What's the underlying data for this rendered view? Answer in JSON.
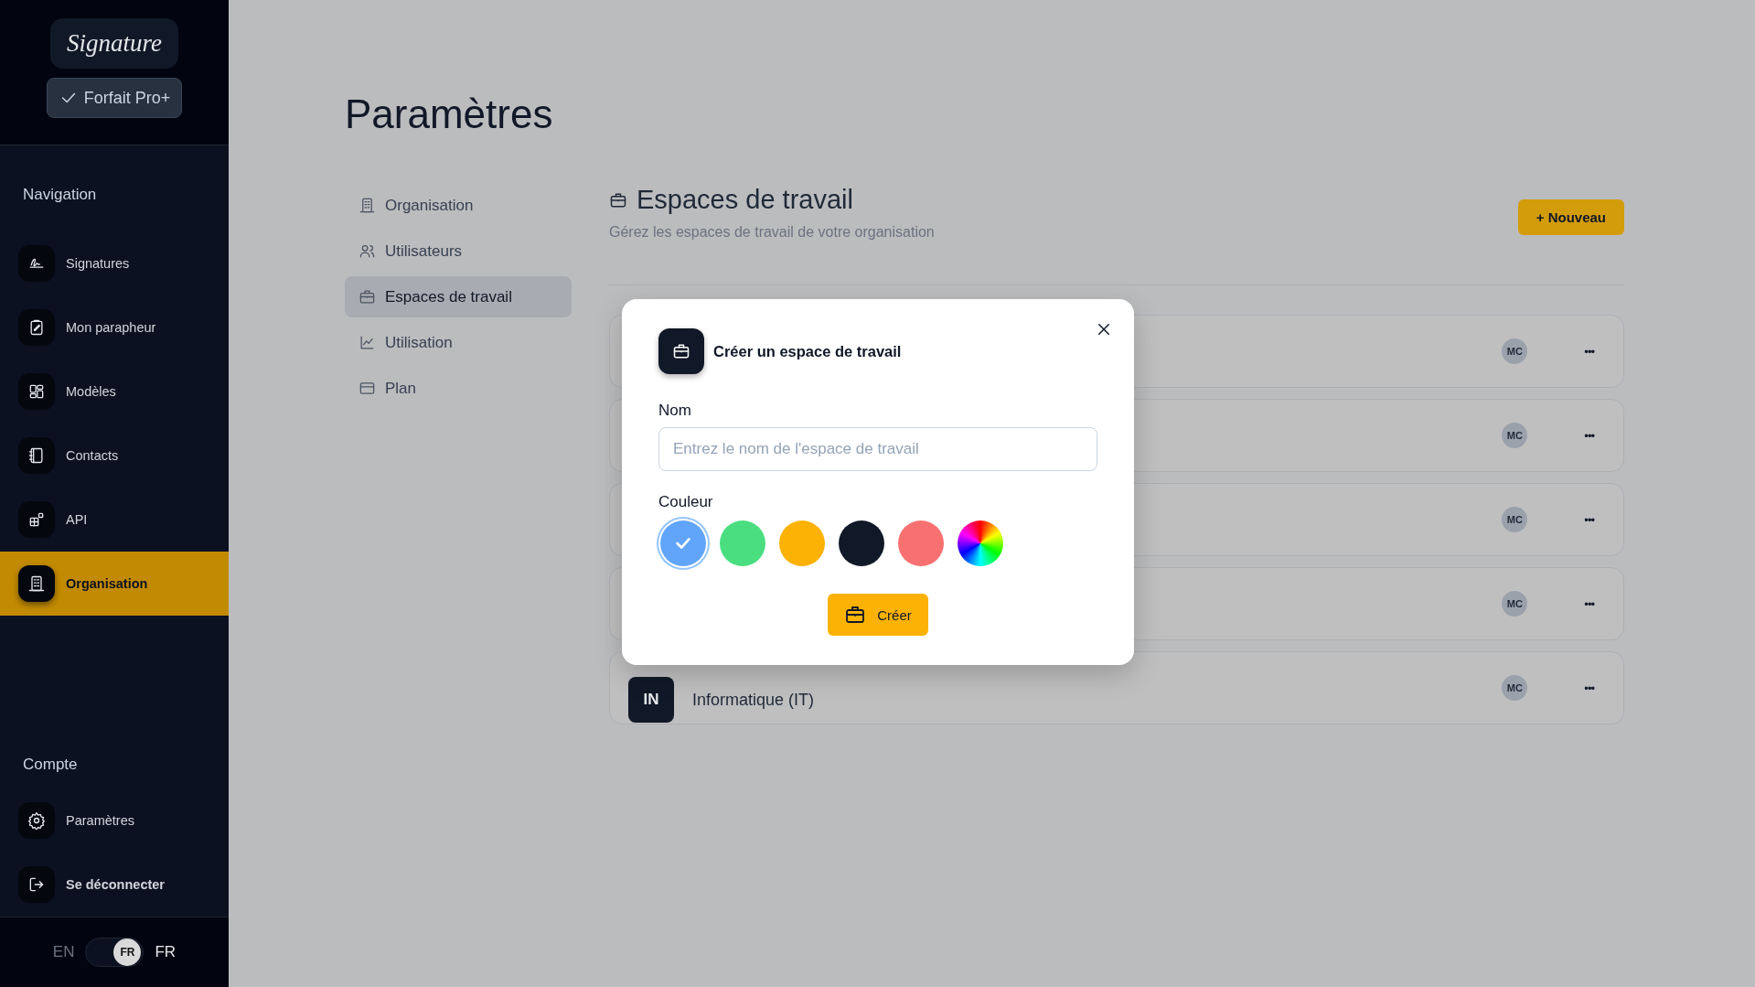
{
  "sidebar": {
    "logo": "Signature",
    "plan_button": "Forfait Pro+",
    "nav_heading": "Navigation",
    "nav_items": [
      {
        "label": "Signatures",
        "selected": false
      },
      {
        "label": "Mon parapheur",
        "selected": false
      },
      {
        "label": "Modèles",
        "selected": false
      },
      {
        "label": "Contacts",
        "selected": false
      },
      {
        "label": "API",
        "selected": false
      },
      {
        "label": "Organisation",
        "selected": true
      }
    ],
    "account_heading": "Compte",
    "account_items": [
      {
        "label": "Paramètres"
      },
      {
        "label": "Se déconnecter"
      }
    ],
    "language": {
      "left": "EN",
      "knob": "FR",
      "right": "FR",
      "on": true
    }
  },
  "page": {
    "title": "Paramètres",
    "menu": [
      {
        "label": "Organisation",
        "selected": false
      },
      {
        "label": "Utilisateurs",
        "selected": false
      },
      {
        "label": "Espaces de travail",
        "selected": true
      },
      {
        "label": "Utilisation",
        "selected": false
      },
      {
        "label": "Plan",
        "selected": false
      }
    ],
    "section": {
      "title": "Espaces de travail",
      "subtitle": "Gérez les espaces de travail de votre organisation",
      "new_button": "+ Nouveau"
    },
    "workspaces": [
      {
        "avatar": "MC",
        "menu": "•••"
      },
      {
        "avatar": "MC",
        "menu": "•••"
      },
      {
        "avatar": "MC",
        "menu": "•••"
      },
      {
        "avatar": "MC",
        "menu": "•••"
      },
      {
        "badge": "IN",
        "name": "Informatique (IT)",
        "avatar": "MC",
        "menu": "•••"
      }
    ]
  },
  "modal": {
    "title": "Créer un espace de travail",
    "name_label": "Nom",
    "placeholder": "Entrez le nom de l'espace de travail",
    "color_label": "Couleur",
    "colors": [
      {
        "kind": "swatch",
        "color": "#60a5fa",
        "selected": true
      },
      {
        "kind": "swatch",
        "color": "#4ade80",
        "selected": false
      },
      {
        "kind": "swatch",
        "color": "#fbb204",
        "selected": false
      },
      {
        "kind": "swatch",
        "color": "#111827",
        "selected": false
      },
      {
        "kind": "swatch",
        "color": "#f87171",
        "selected": false
      },
      {
        "kind": "picker",
        "selected": false
      }
    ],
    "submit": "Créer"
  }
}
